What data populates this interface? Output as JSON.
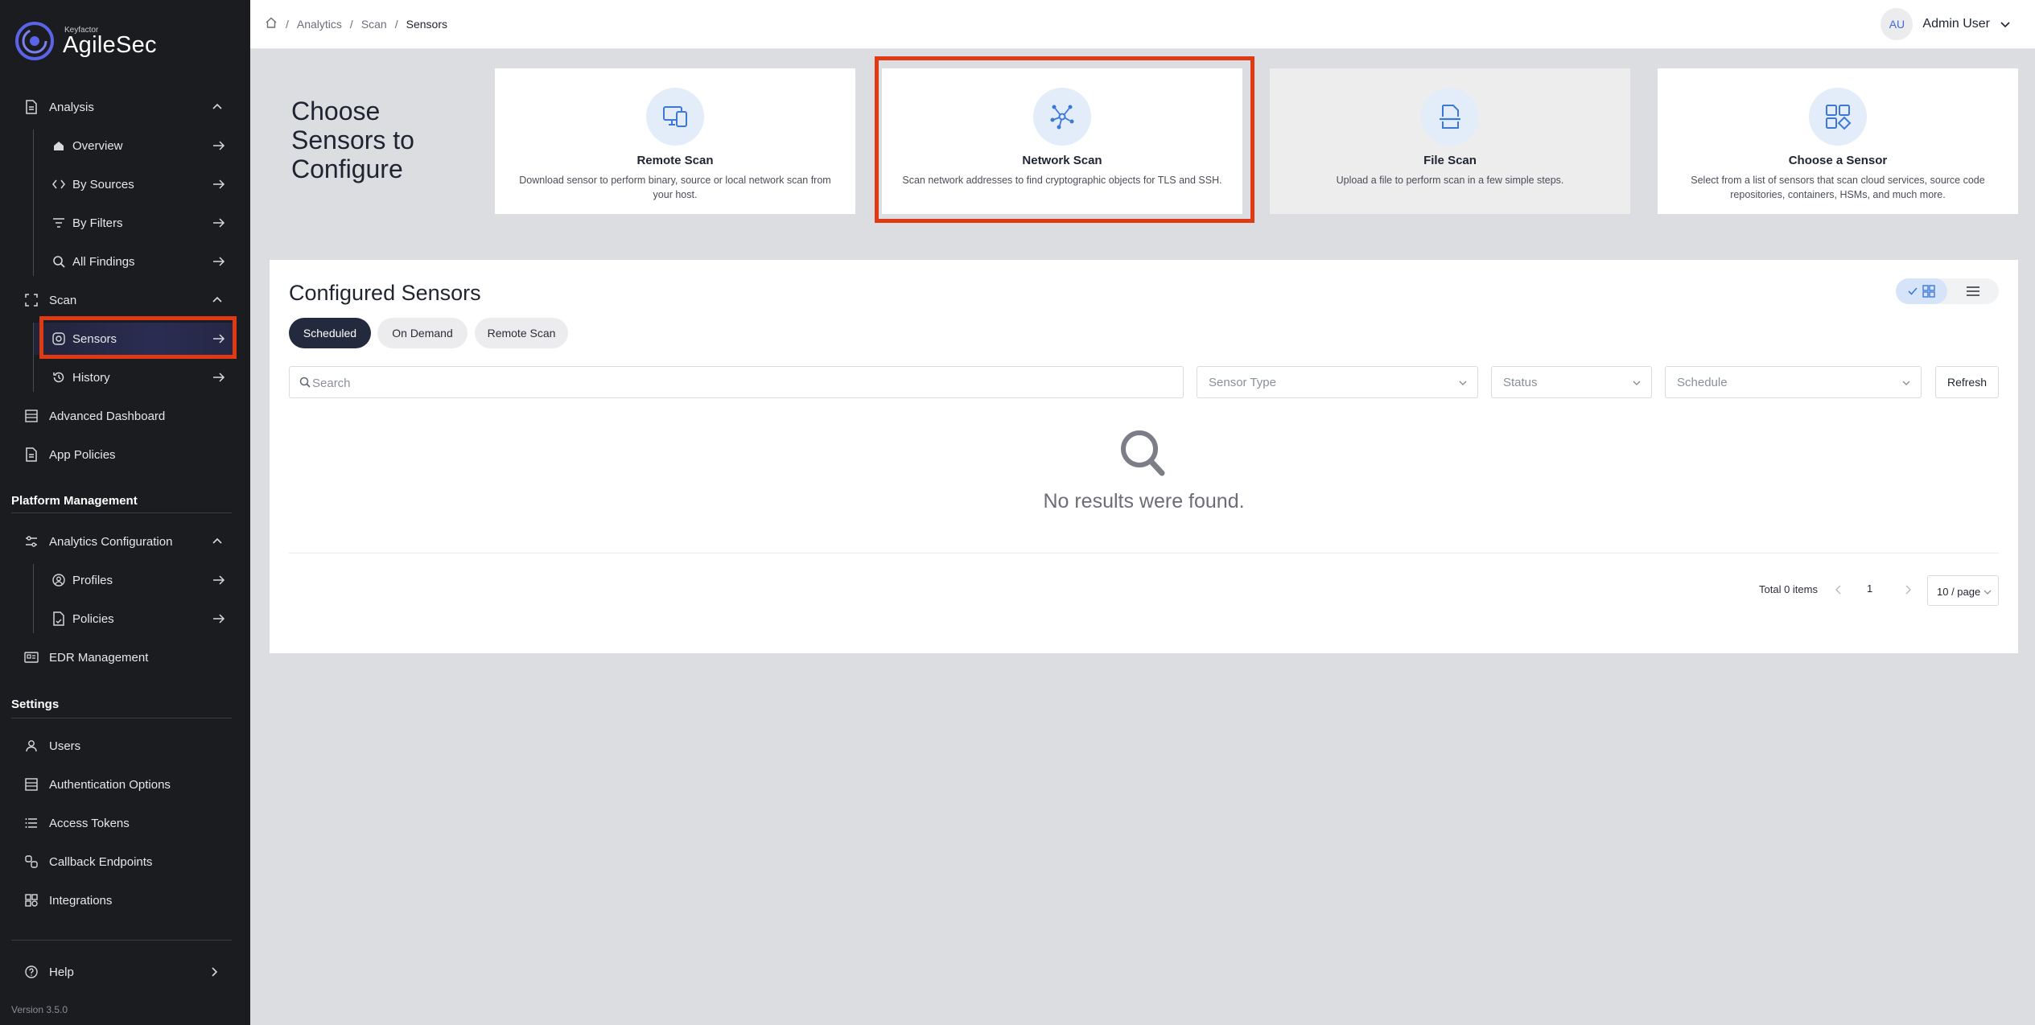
{
  "brand": {
    "company": "Keyfactor",
    "product": "AgileSec"
  },
  "sidebar": {
    "analysis": {
      "label": "Analysis",
      "items": [
        "Overview",
        "By Sources",
        "By Filters",
        "All Findings"
      ]
    },
    "scan": {
      "label": "Scan",
      "items": [
        "Sensors",
        "History"
      ]
    },
    "advanced_dashboard": "Advanced Dashboard",
    "app_policies": "App Policies",
    "platform_management": {
      "title": "Platform Management",
      "analytics_configuration": {
        "label": "Analytics Configuration",
        "items": [
          "Profiles",
          "Policies"
        ]
      },
      "edr_management": "EDR Management"
    },
    "settings": {
      "title": "Settings",
      "items": [
        "Users",
        "Authentication Options",
        "Access Tokens",
        "Callback Endpoints",
        "Integrations"
      ]
    },
    "help": "Help",
    "version": "Version 3.5.0",
    "active_item": "Sensors"
  },
  "header": {
    "breadcrumb": [
      "Analytics",
      "Scan",
      "Sensors"
    ],
    "user": {
      "initials": "AU",
      "name": "Admin User"
    }
  },
  "choose": {
    "title": "Choose Sensors to Configure",
    "cards": [
      {
        "title": "Remote Scan",
        "description": "Download sensor to perform binary, source or local network scan from your host.",
        "icon": "remote-scan-icon"
      },
      {
        "title": "Network Scan",
        "description": "Scan network addresses to find cryptographic objects for TLS and SSH.",
        "icon": "network-scan-icon"
      },
      {
        "title": "File Scan",
        "description": "Upload a file to perform scan in a few simple steps.",
        "icon": "file-scan-icon"
      },
      {
        "title": "Choose a Sensor",
        "description": "Select from a list of sensors that scan cloud services, source code repositories, containers, HSMs, and much more.",
        "icon": "choose-sensor-icon"
      }
    ],
    "highlighted_card": "Network Scan"
  },
  "configured": {
    "title": "Configured Sensors",
    "tabs": [
      "Scheduled",
      "On Demand",
      "Remote Scan"
    ],
    "active_tab": "Scheduled",
    "search_placeholder": "Search",
    "filters": {
      "sensor_type": "Sensor Type",
      "status": "Status",
      "schedule": "Schedule"
    },
    "refresh_label": "Refresh",
    "empty_message": "No results were found.",
    "pagination": {
      "total": "Total 0 items",
      "page": "1",
      "page_size": "10 / page"
    }
  },
  "colors": {
    "highlight": "#e03a14",
    "accent": "#3d78d8",
    "sidebar_bg": "#1b1c1f",
    "active_tab_bg": "#242a3e"
  }
}
